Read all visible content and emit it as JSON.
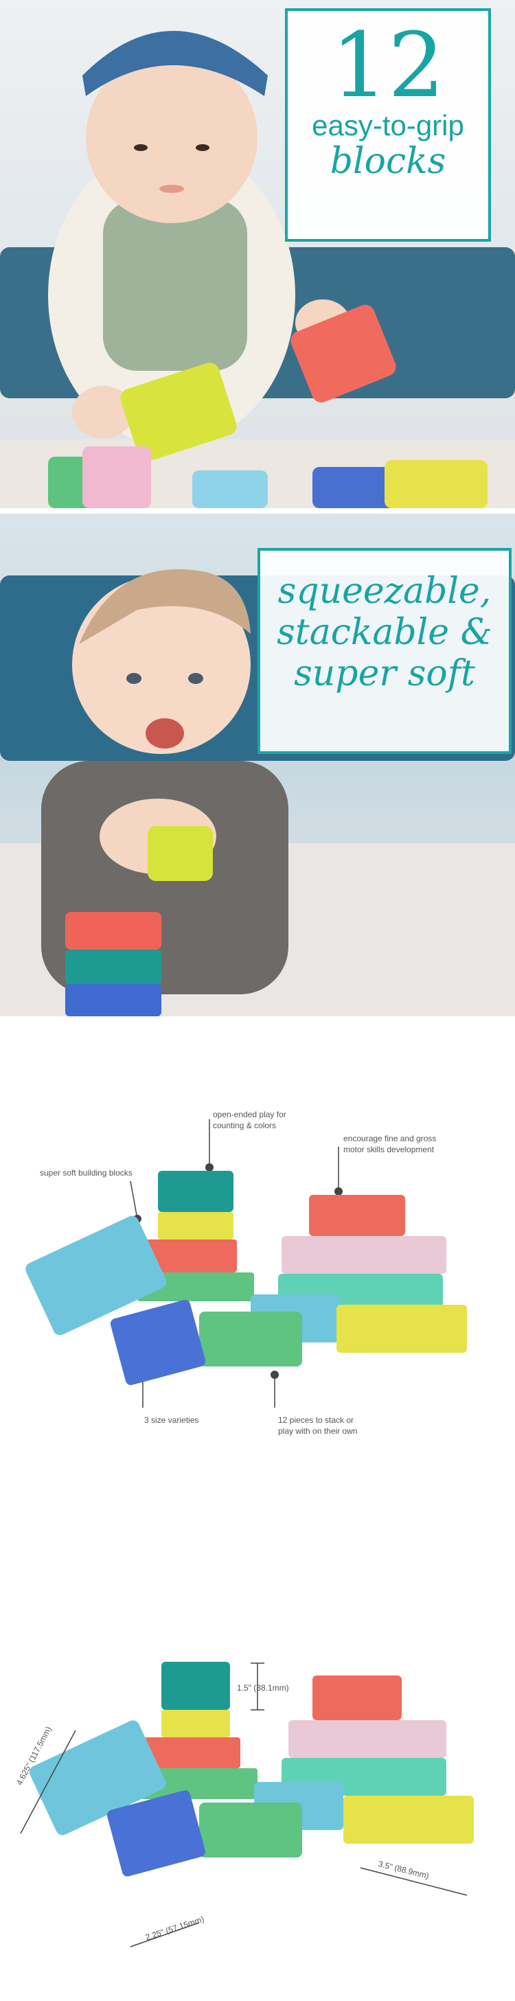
{
  "panel1": {
    "callout": {
      "number": "12",
      "line1": "easy-to-grip",
      "line2": "blocks"
    }
  },
  "panel2": {
    "callout": {
      "line1": "squeezable,",
      "line2": "stackable &",
      "line3": "super soft"
    }
  },
  "features": {
    "open_ended": "open-ended play for\ncounting & colors",
    "motor": "encourage fine and gross\nmotor skills development",
    "super_soft": "super soft building blocks",
    "sizes": "3 size varieties",
    "pieces": "12 pieces to stack or\nplay with on their own"
  },
  "dimensions": {
    "height": "1.5\" (38.1mm)",
    "length": "4.625\" (117.5mm)",
    "width_small": "2.25\" (57.15mm)",
    "width_large": "3.5\" (88.9mm)"
  },
  "colors": {
    "teal": "#1aa6a6",
    "block_blue": "#6fc6dc",
    "block_dark_teal": "#1f9a93",
    "block_yellow": "#e6e24a",
    "block_red": "#ee6a5c",
    "block_pink": "#e9c9d6",
    "block_mint": "#5fd1b5",
    "block_green": "#5fc382",
    "block_royal": "#4a72d6"
  }
}
